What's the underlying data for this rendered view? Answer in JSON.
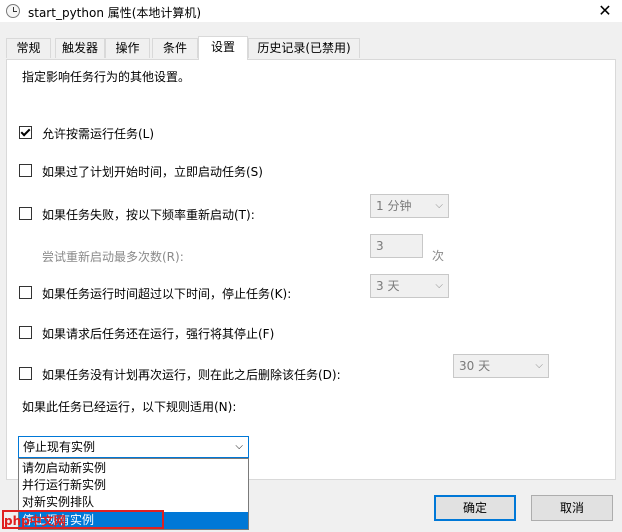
{
  "window": {
    "title": "start_python 属性(本地计算机)",
    "close_glyph": "✕"
  },
  "tabs": [
    "常规",
    "触发器",
    "操作",
    "条件",
    "设置",
    "历史记录(已禁用)"
  ],
  "description": "指定影响任务行为的其他设置。",
  "settings": {
    "allow_on_demand": "允许按需运行任务(L)",
    "run_if_missed": "如果过了计划开始时间，立即启动任务(S)",
    "restart_on_failure": "如果任务失败，按以下频率重新启动(T):",
    "restart_interval": "1 分钟",
    "retry_attempts_label": "尝试重新启动最多次数(R):",
    "retry_attempts_value": "3",
    "retry_unit": "次",
    "stop_if_runs_longer": "如果任务运行时间超过以下时间，停止任务(K):",
    "stop_duration": "3 天",
    "force_stop": "如果请求后任务还在运行，强行将其停止(F)",
    "delete_if_not_scheduled": "如果任务没有计划再次运行，则在此之后删除该任务(D):",
    "delete_after": "30 天",
    "rule_label": "如果此任务已经运行，以下规则适用(N):"
  },
  "rule_select": {
    "value": "停止现有实例",
    "options": [
      "请勿启动新实例",
      "并行运行新实例",
      "对新实例排队",
      "停止现有实例"
    ],
    "selected_index": 3
  },
  "buttons": {
    "ok": "确定",
    "cancel": "取消"
  },
  "watermark": "php中文网",
  "colors": {
    "accent": "#0078d7",
    "highlight": "#e02020"
  }
}
